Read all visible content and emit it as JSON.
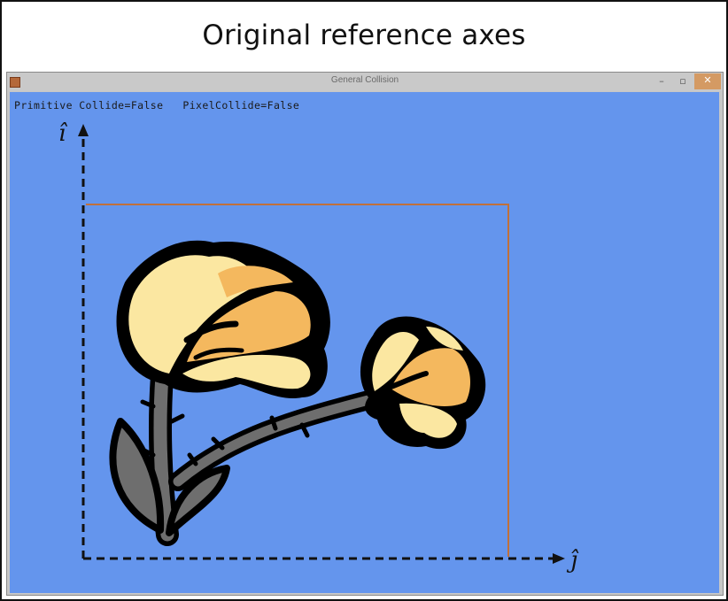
{
  "caption": {
    "text": "Original reference axes"
  },
  "window": {
    "title": "General Collision",
    "buttons": {
      "minimize": "–",
      "maximize": "▫",
      "close": "✕"
    }
  },
  "status": {
    "text": "Primitive Collide=False   PixelCollide=False"
  },
  "axes": {
    "vertical_label": "î",
    "horizontal_label": "ĵ"
  },
  "colors": {
    "client_bg": "#6495ED",
    "bounding_box": "#C0703A",
    "petal_light": "#FBE7A1",
    "petal_dark": "#F4B85E",
    "stem": "#6E6E6E",
    "outline": "#000000"
  },
  "icons": {
    "app": "app-icon",
    "minimize": "minimize-icon",
    "maximize": "maximize-icon",
    "close": "close-icon"
  }
}
